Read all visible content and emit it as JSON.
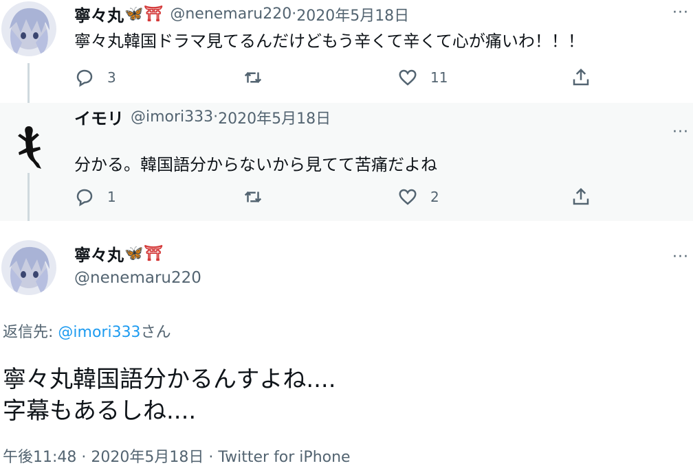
{
  "tweets": [
    {
      "display_name": "寧々丸",
      "name_emoji_1": "🦋",
      "name_emoji_2": "⛩",
      "handle": "@nenemaru220",
      "separator": " · ",
      "date": "2020年5月18日",
      "text": "寧々丸韓国ドラマ見てるんだけどもう辛くて辛くて心が痛いわ！！！",
      "reply_count": "3",
      "retweet_count": "",
      "like_count": "11",
      "more": "···"
    },
    {
      "display_name": "イモリ",
      "handle": "@imori333",
      "separator": " · ",
      "date": "2020年5月18日",
      "text": "分かる。韓国語分からないから見てて苦痛だよね",
      "reply_count": "1",
      "retweet_count": "",
      "like_count": "2",
      "more": "···"
    }
  ],
  "focused": {
    "display_name": "寧々丸",
    "name_emoji_1": "🦋",
    "name_emoji_2": "⛩",
    "handle": "@nenemaru220",
    "more": "···",
    "reply_to_label": "返信先: ",
    "reply_to_handle": "@imori333",
    "reply_to_suffix": "さん",
    "text_line1": "寧々丸韓国語分かるんすよね....",
    "text_line2": "字幕もあるしね....",
    "footer": "午後11:48 · 2020年5月18日 · Twitter for iPhone"
  },
  "icons": {
    "reply": "reply-icon",
    "retweet": "retweet-icon",
    "like": "like-icon",
    "share": "share-icon",
    "more": "more-icon"
  },
  "colors": {
    "text_primary": "#0f1419",
    "text_secondary": "#536471",
    "link": "#1d9bf0",
    "thread_line": "#cfd9de",
    "reply_bg": "#f7f9f9"
  }
}
